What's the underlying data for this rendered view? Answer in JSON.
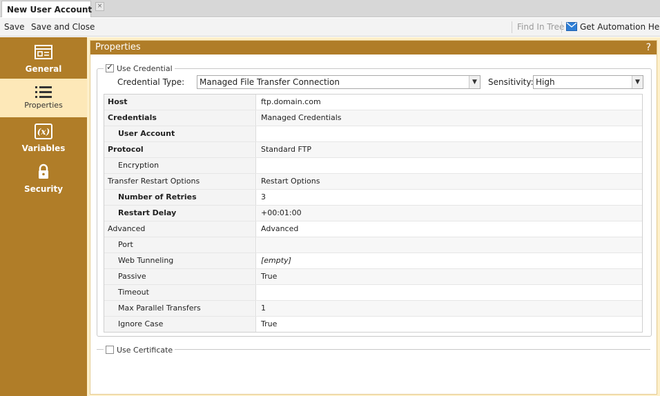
{
  "tab": {
    "title": "New User Account",
    "close_label": "×"
  },
  "toolbar": {
    "save_label": "Save",
    "save_close_label": "Save and Close",
    "find_in_tree_label": "Find In Tree",
    "automation_help_label": "Get Automation Help..."
  },
  "sidebar": {
    "items": [
      {
        "label": "General",
        "icon": "general-icon"
      },
      {
        "label": "Properties",
        "icon": "list-icon"
      },
      {
        "label": "Variables",
        "icon": "variable-icon"
      },
      {
        "label": "Security",
        "icon": "lock-icon"
      }
    ],
    "active": "Properties"
  },
  "panel": {
    "title": "Properties",
    "help": "?"
  },
  "credential": {
    "use_label": "Use Credential",
    "checked": true,
    "type_label": "Credential Type:",
    "type_value": "Managed File Transfer Connection",
    "sensitivity_label": "Sensitivity:",
    "sensitivity_value": "High"
  },
  "properties": [
    {
      "name": "Host",
      "value": "ftp.domain.com"
    },
    {
      "name": "Credentials",
      "value": "Managed Credentials"
    },
    {
      "name": "User Account",
      "value": ""
    },
    {
      "name": "Protocol",
      "value": "Standard FTP"
    },
    {
      "name": "Encryption",
      "value": ""
    },
    {
      "name": "Transfer Restart Options",
      "value": "Restart Options"
    },
    {
      "name": "Number of Retries",
      "value": "3"
    },
    {
      "name": "Restart Delay",
      "value": "+00:01:00"
    },
    {
      "name": "Advanced",
      "value": "Advanced"
    },
    {
      "name": "Port",
      "value": ""
    },
    {
      "name": "Web Tunneling",
      "value": "[empty]"
    },
    {
      "name": "Passive",
      "value": "True"
    },
    {
      "name": "Timeout",
      "value": ""
    },
    {
      "name": "Max Parallel Transfers",
      "value": "1"
    },
    {
      "name": "Ignore Case",
      "value": "True"
    }
  ],
  "certificate": {
    "use_label": "Use Certificate",
    "checked": false
  },
  "colors": {
    "accent": "#b07d28",
    "active_bg": "#fde8b8",
    "panel_bg": "#fdefc9"
  }
}
